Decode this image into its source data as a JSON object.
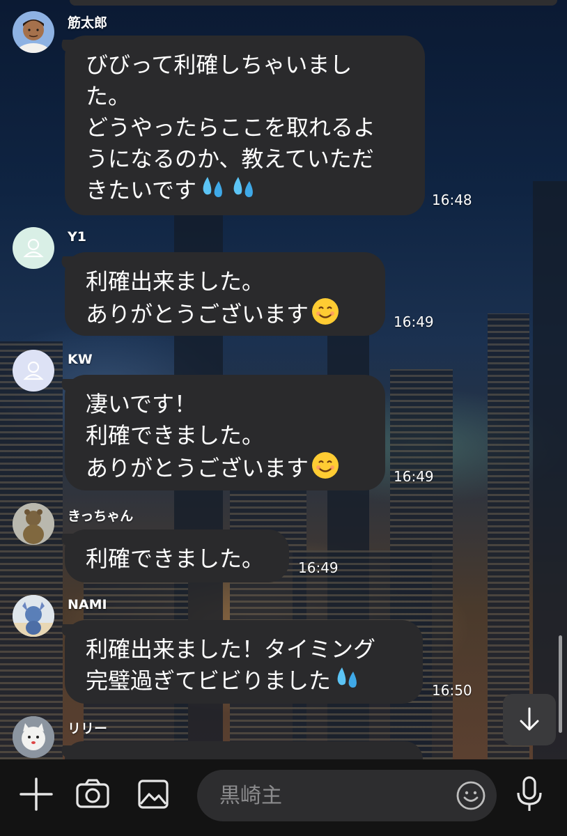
{
  "chat": {
    "messages": [
      {
        "sender": "筋太郎",
        "avatar_icon": "man-portrait-avatar",
        "lines": [
          "びびって利確しちゃいまし",
          "た。",
          "どうやったらここを取れるよ",
          "うになるのか、教えていただ",
          "きたいです"
        ],
        "emojis": [
          "sweat-droplets",
          "sweat-droplets"
        ],
        "time": "16:48"
      },
      {
        "sender": "Y1",
        "avatar_icon": "default-person-avatar",
        "lines": [
          "利確出来ました。",
          "ありがとうございます"
        ],
        "emojis": [
          "smiling-face"
        ],
        "time": "16:49"
      },
      {
        "sender": "KW",
        "avatar_icon": "default-person-avatar",
        "lines": [
          "凄いです！",
          "利確できました。",
          "ありがとうございます"
        ],
        "emojis": [
          "smiling-face"
        ],
        "time": "16:49"
      },
      {
        "sender": "きっちゃん",
        "avatar_icon": "teddy-bear-photo-avatar",
        "lines": [
          "利確できました。"
        ],
        "emojis": [],
        "time": "16:49"
      },
      {
        "sender": "NAMI",
        "avatar_icon": "character-photo-avatar",
        "lines": [
          "利確出来ました！タイミング",
          "完璧過ぎてビビりました"
        ],
        "emojis": [
          "sweat-droplets"
        ],
        "time": "16:50"
      },
      {
        "sender": "リリー",
        "avatar_icon": "lucky-cat-photo-avatar",
        "lines": [],
        "emojis": [],
        "time": ""
      }
    ]
  },
  "composer": {
    "placeholder": "黒崎主",
    "icons": [
      "plus-icon",
      "camera-icon",
      "image-icon",
      "emoji-icon",
      "microphone-icon"
    ]
  },
  "scroll_button_icon": "arrow-down-icon",
  "colors": {
    "bubble": "#2a2a2c",
    "composer_bg": "#131313",
    "input_bg": "#2d2d2f",
    "text": "#ffffff",
    "placeholder": "#8c8c8e"
  }
}
